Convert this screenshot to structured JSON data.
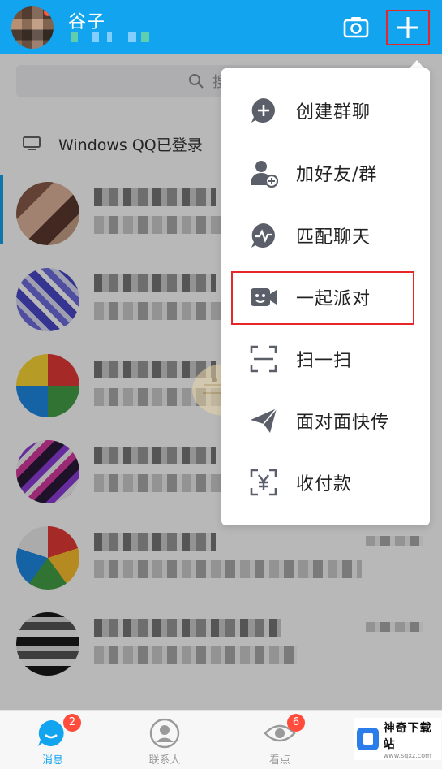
{
  "header": {
    "user_name": "谷子",
    "camera_icon": "camera-icon",
    "plus_icon": "plus-icon"
  },
  "search": {
    "placeholder": "搜"
  },
  "device_notice": {
    "text": "Windows QQ已登录",
    "icon": "computer-icon"
  },
  "popup_menu": {
    "items": [
      {
        "label": "创建群聊",
        "icon": "create-group-icon"
      },
      {
        "label": "加好友/群",
        "icon": "add-friend-icon"
      },
      {
        "label": "匹配聊天",
        "icon": "match-chat-icon"
      },
      {
        "label": "一起派对",
        "icon": "party-icon"
      },
      {
        "label": "扫一扫",
        "icon": "scan-icon"
      },
      {
        "label": "面对面快传",
        "icon": "face-transfer-icon"
      },
      {
        "label": "收付款",
        "icon": "payment-icon"
      }
    ],
    "highlighted_item": "一起派对"
  },
  "tabbar": {
    "tabs": [
      {
        "label": "消息",
        "badge": "2",
        "icon": "message-icon"
      },
      {
        "label": "联系人",
        "icon": "contacts-icon"
      },
      {
        "label": "看点",
        "badge": "6",
        "icon": "eye-icon"
      }
    ]
  },
  "brand": {
    "title": "神奇下载站",
    "url": "www.sqxz.com"
  },
  "colors": {
    "header_bg": "#12a4ee",
    "highlight_border": "#e8262a",
    "badge": "#ff4c3c"
  }
}
